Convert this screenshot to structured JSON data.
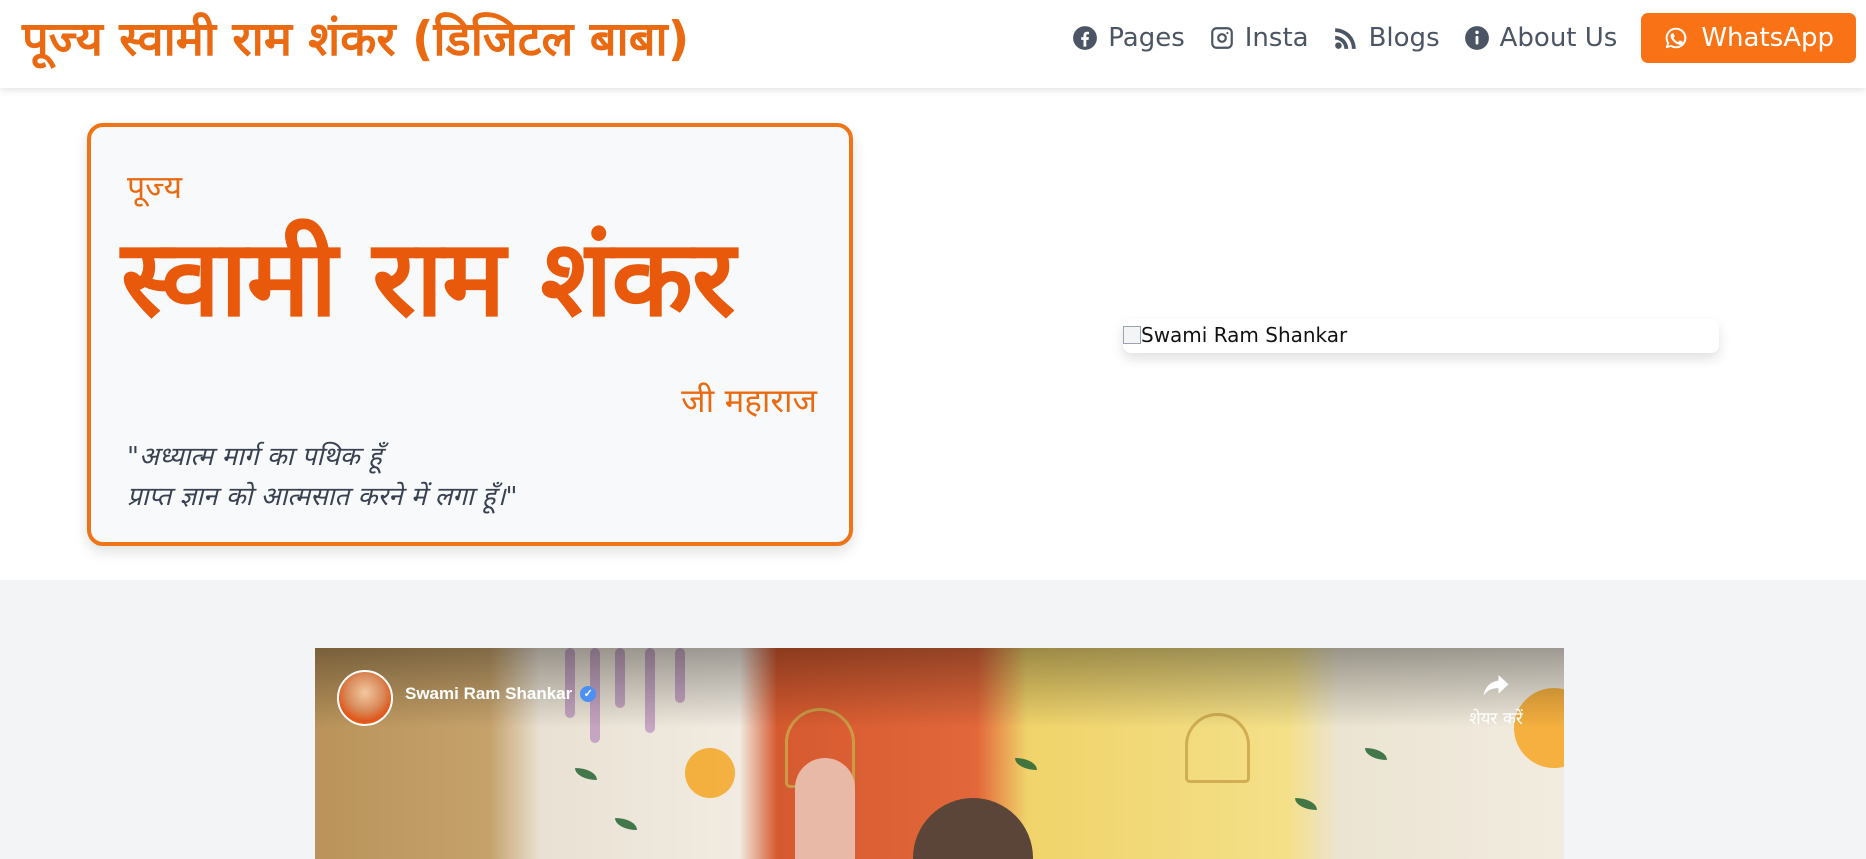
{
  "header": {
    "site_title": "पूज्य स्वामी राम शंकर (डिजिटल बाबा)",
    "nav": [
      {
        "label": "Pages",
        "icon": "facebook-icon"
      },
      {
        "label": "Insta",
        "icon": "instagram-icon"
      },
      {
        "label": "Blogs",
        "icon": "rss-icon"
      },
      {
        "label": "About Us",
        "icon": "info-icon"
      }
    ],
    "whatsapp_label": "WhatsApp"
  },
  "hero": {
    "pujya": "पूज्य",
    "name": "स्वामी राम शंकर",
    "suffix": "जी महाराज",
    "quote_line1": "\"अध्यात्म मार्ग का पथिक हूँ",
    "quote_line2": "प्राप्त ज्ञान को आत्मसात करने में लगा हूँ।\"",
    "image_alt": "Swami Ram Shankar"
  },
  "video": {
    "channel_name": "Swami Ram Shankar",
    "share_label": "शेयर करें"
  },
  "colors": {
    "accent": "#f97316",
    "title": "#ea6a12",
    "card_border": "#ef7418",
    "section_bg": "#f3f4f6"
  }
}
